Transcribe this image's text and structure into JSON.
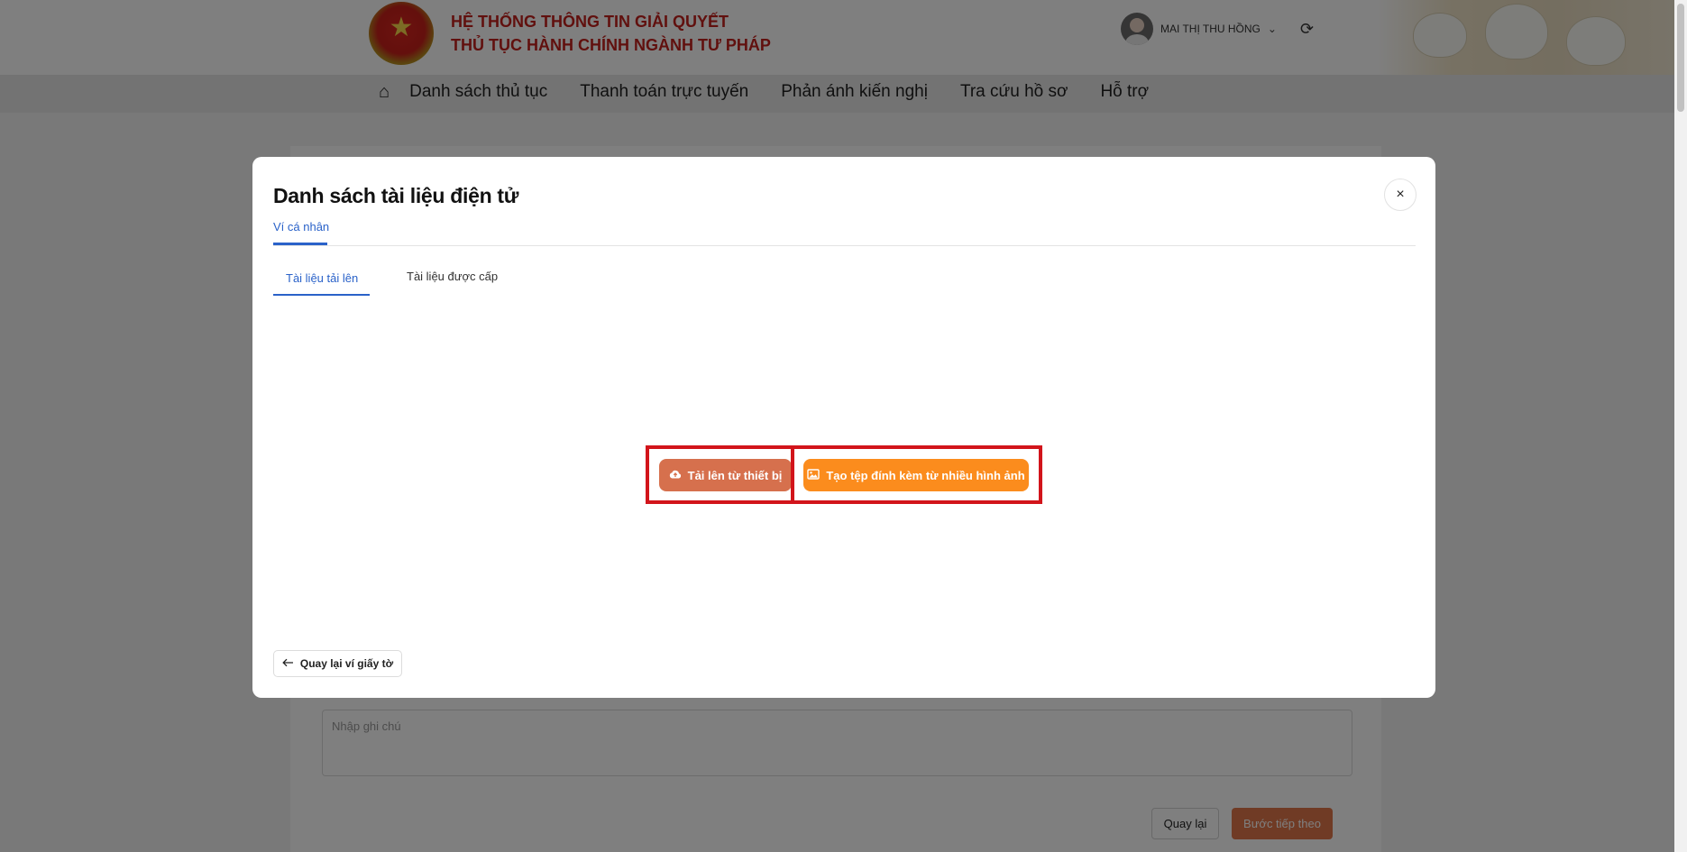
{
  "header": {
    "title_line1": "HỆ THỐNG THÔNG TIN GIẢI QUYẾT",
    "title_line2": "THỦ TỤC HÀNH CHÍNH NGÀNH TƯ PHÁP",
    "user_name": "MAI THỊ THU HỒNG"
  },
  "nav": {
    "items": [
      "Danh sách thủ tục",
      "Thanh toán trực tuyến",
      "Phản ánh kiến nghị",
      "Tra cứu hồ sơ",
      "Hỗ trợ"
    ]
  },
  "background_form": {
    "note_placeholder": "Nhập ghi chú",
    "back_label": "Quay lại",
    "next_label": "Bước tiếp theo"
  },
  "modal": {
    "title": "Danh sách tài liệu điện tử",
    "close_symbol": "×",
    "tab_wallet": "Ví cá nhân",
    "subtab_uploaded": "Tài liệu tải lên",
    "subtab_issued": "Tài liệu được cấp",
    "upload_label": "Tải lên từ thiết bị",
    "attach_label": "Tạo tệp đính kèm từ nhiều hình ảnh",
    "back_to_wallet_label": "Quay lại ví giấy tờ"
  },
  "icons": {
    "home": "home-icon",
    "chevron": "chevron-down-icon",
    "refresh": "refresh-icon",
    "close": "close-icon",
    "cloud_upload": "cloud-upload-icon",
    "image": "image-icon",
    "arrow_left": "arrow-left-icon"
  },
  "colors": {
    "brand_red": "#c2201c",
    "accent_blue": "#2a62c9",
    "upload_button": "#d6704d",
    "attach_button": "#fb8c1d",
    "highlight_box": "#d2141b"
  }
}
